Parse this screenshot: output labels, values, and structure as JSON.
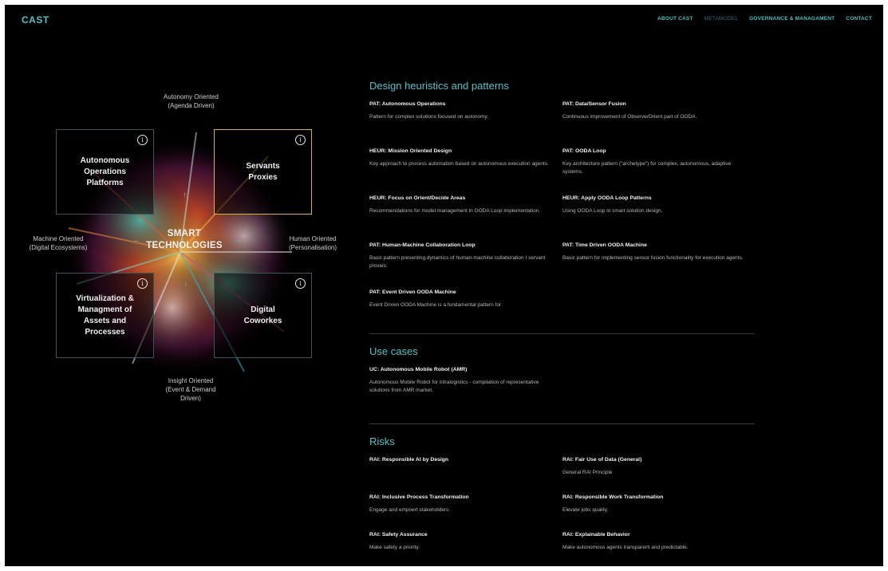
{
  "header": {
    "logo": "CAST",
    "nav": [
      {
        "label": "ABOUT CAST",
        "active": false
      },
      {
        "label": "METAMODEL",
        "active": true
      },
      {
        "label": "GOVERNANCE & MANAGAMENT",
        "active": false
      },
      {
        "label": "CONTACT",
        "active": false
      }
    ]
  },
  "diagram": {
    "axes": {
      "top": "Autonomy Oriented\n(Agenda Driven)",
      "left": "Machine Oriented\n(Digital Ecosystems)",
      "right": "Human Oriented\n(Personalisation)",
      "bottom": "Insight Oriented\n(Event & Demand\nDriven)"
    },
    "center": "SMART\nTECHNOLOGIES",
    "quadrants": {
      "top_left": "Autonomous\nOperations\nPlatforms",
      "top_right": "Servants\nProxies",
      "bottom_left": "Virtualization &\nManagment of\nAssets and\nProcesses",
      "bottom_right": "Digital\nCoworkes"
    },
    "info_glyph": "i"
  },
  "sections": {
    "patterns": {
      "title": "Design heuristics and patterns",
      "items": [
        {
          "title": "PAT: Autonomous Operations",
          "desc": "Pattern for complex solutions focused on autonomy."
        },
        {
          "title": "PAT: Data/Sensor Fusion",
          "desc": "Continuous improvement of Observe/Orient part of OODA."
        },
        {
          "title": "HEUR: Mission Oriented Design",
          "desc": "Key approach to process automation based on autonomous execution agents."
        },
        {
          "title": "PAT: OODA Loop",
          "desc": "Key architecture pattern (\"archetype\") for complex, autonomous, adaptive systems."
        },
        {
          "title": "HEUR: Focus on Orient/Decide Areas",
          "desc": "Recommendations for model management in OODA Loop implementation."
        },
        {
          "title": "HEUR: Apply OODA Loop Patterns",
          "desc": "Using OODA Loop in smart solution design."
        },
        {
          "title": "PAT: Human-Machine Collaboration Loop",
          "desc": "Basic pattern presenting dynamics of human-machine collaboration I servant proxies."
        },
        {
          "title": "PAT: Time Driven OODA Machine",
          "desc": "Basic pattern for implementing sensor fusion functionality for execution agents."
        },
        {
          "title": "PAT: Event Driven OODA Machine",
          "desc": "Event Driven OODA Machine is a fundamental pattern for"
        }
      ]
    },
    "use_cases": {
      "title": "Use cases",
      "items": [
        {
          "title": "UC: Autonomous Mobile Robot (AMR)",
          "desc": "Autonomous Mobile Robot for intralogistics - compilation of representative solutions from AMR market."
        }
      ]
    },
    "risks": {
      "title": "Risks",
      "items": [
        {
          "title": "RAI: Responsible AI by Design",
          "desc": ""
        },
        {
          "title": "RAI: Fair Use of Data (General)",
          "desc": "General RAI Principle"
        },
        {
          "title": "RAI: Inclusive Process Transformation",
          "desc": "Engage and empoert stakeholders."
        },
        {
          "title": "RAI: Responsible Work Transformation",
          "desc": "Elevate jobs quality."
        },
        {
          "title": "RAI: Safety Assurance",
          "desc": "Make safety a priority."
        },
        {
          "title": "RAI: Explainable Behavior",
          "desc": "Make autonomous agents transparent and predictable."
        }
      ]
    }
  },
  "colors": {
    "accent": "#4fc3c8",
    "highlight_border": "#d7b44a",
    "background": "#000000"
  }
}
